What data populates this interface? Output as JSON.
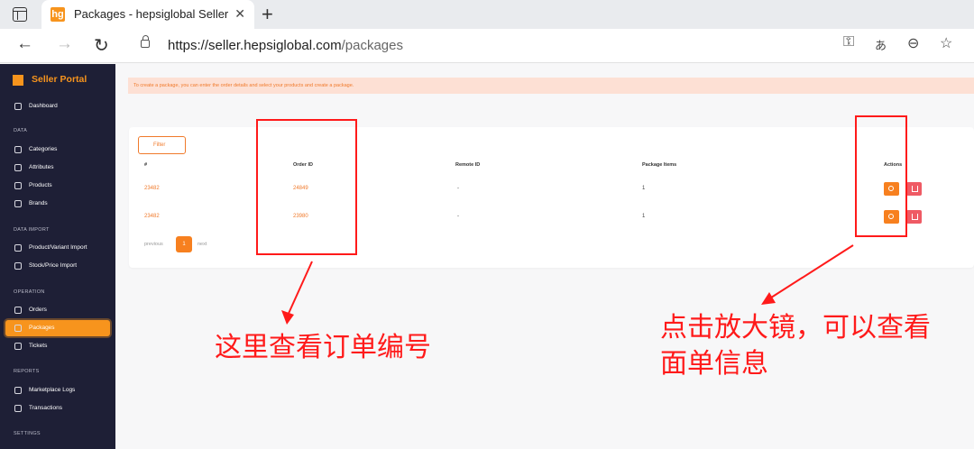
{
  "browser": {
    "tab_title": "Packages - hepsiglobal Seller Por",
    "favicon_text": "hg",
    "url_host": "https://seller.hepsiglobal.com",
    "url_path": "/packages"
  },
  "sidebar": {
    "brand": "Seller Portal",
    "dashboard": "Dashboard",
    "sections": {
      "data": "DATA",
      "data_import": "DATA IMPORT",
      "operation": "OPERATION",
      "reports": "REPORTS",
      "settings": "SETTINGS"
    },
    "items": {
      "categories": "Categories",
      "attributes": "Attributes",
      "products": "Products",
      "brands": "Brands",
      "product_import": "Product/Variant Import",
      "stock_import": "Stock/Price Import",
      "orders": "Orders",
      "packages": "Packages",
      "tickets": "Tickets",
      "marketplace_logs": "Marketplace Logs",
      "transactions": "Transactions"
    }
  },
  "notice": "To create a package, you can enter the order details and select your products and create a package.",
  "filter_label": "Filter",
  "table": {
    "headers": [
      "#",
      "Order ID",
      "Remote ID",
      "Package Items",
      "Actions"
    ],
    "rows": [
      {
        "id": "23482",
        "order_id": "24849",
        "remote_id": "-",
        "items": "1"
      },
      {
        "id": "23482",
        "order_id": "23980",
        "remote_id": "-",
        "items": "1"
      }
    ]
  },
  "pagination": {
    "previous": "previous",
    "page": "1",
    "next": "next"
  },
  "annotations": {
    "left": "这里查看订单编号",
    "right_line1": "点击放大镜，可以查看",
    "right_line2": "面单信息"
  },
  "colors": {
    "accent": "#f7801f",
    "sidebar": "#1e1f36",
    "annotation": "#ff1a1a",
    "delete": "#ef5a64"
  }
}
